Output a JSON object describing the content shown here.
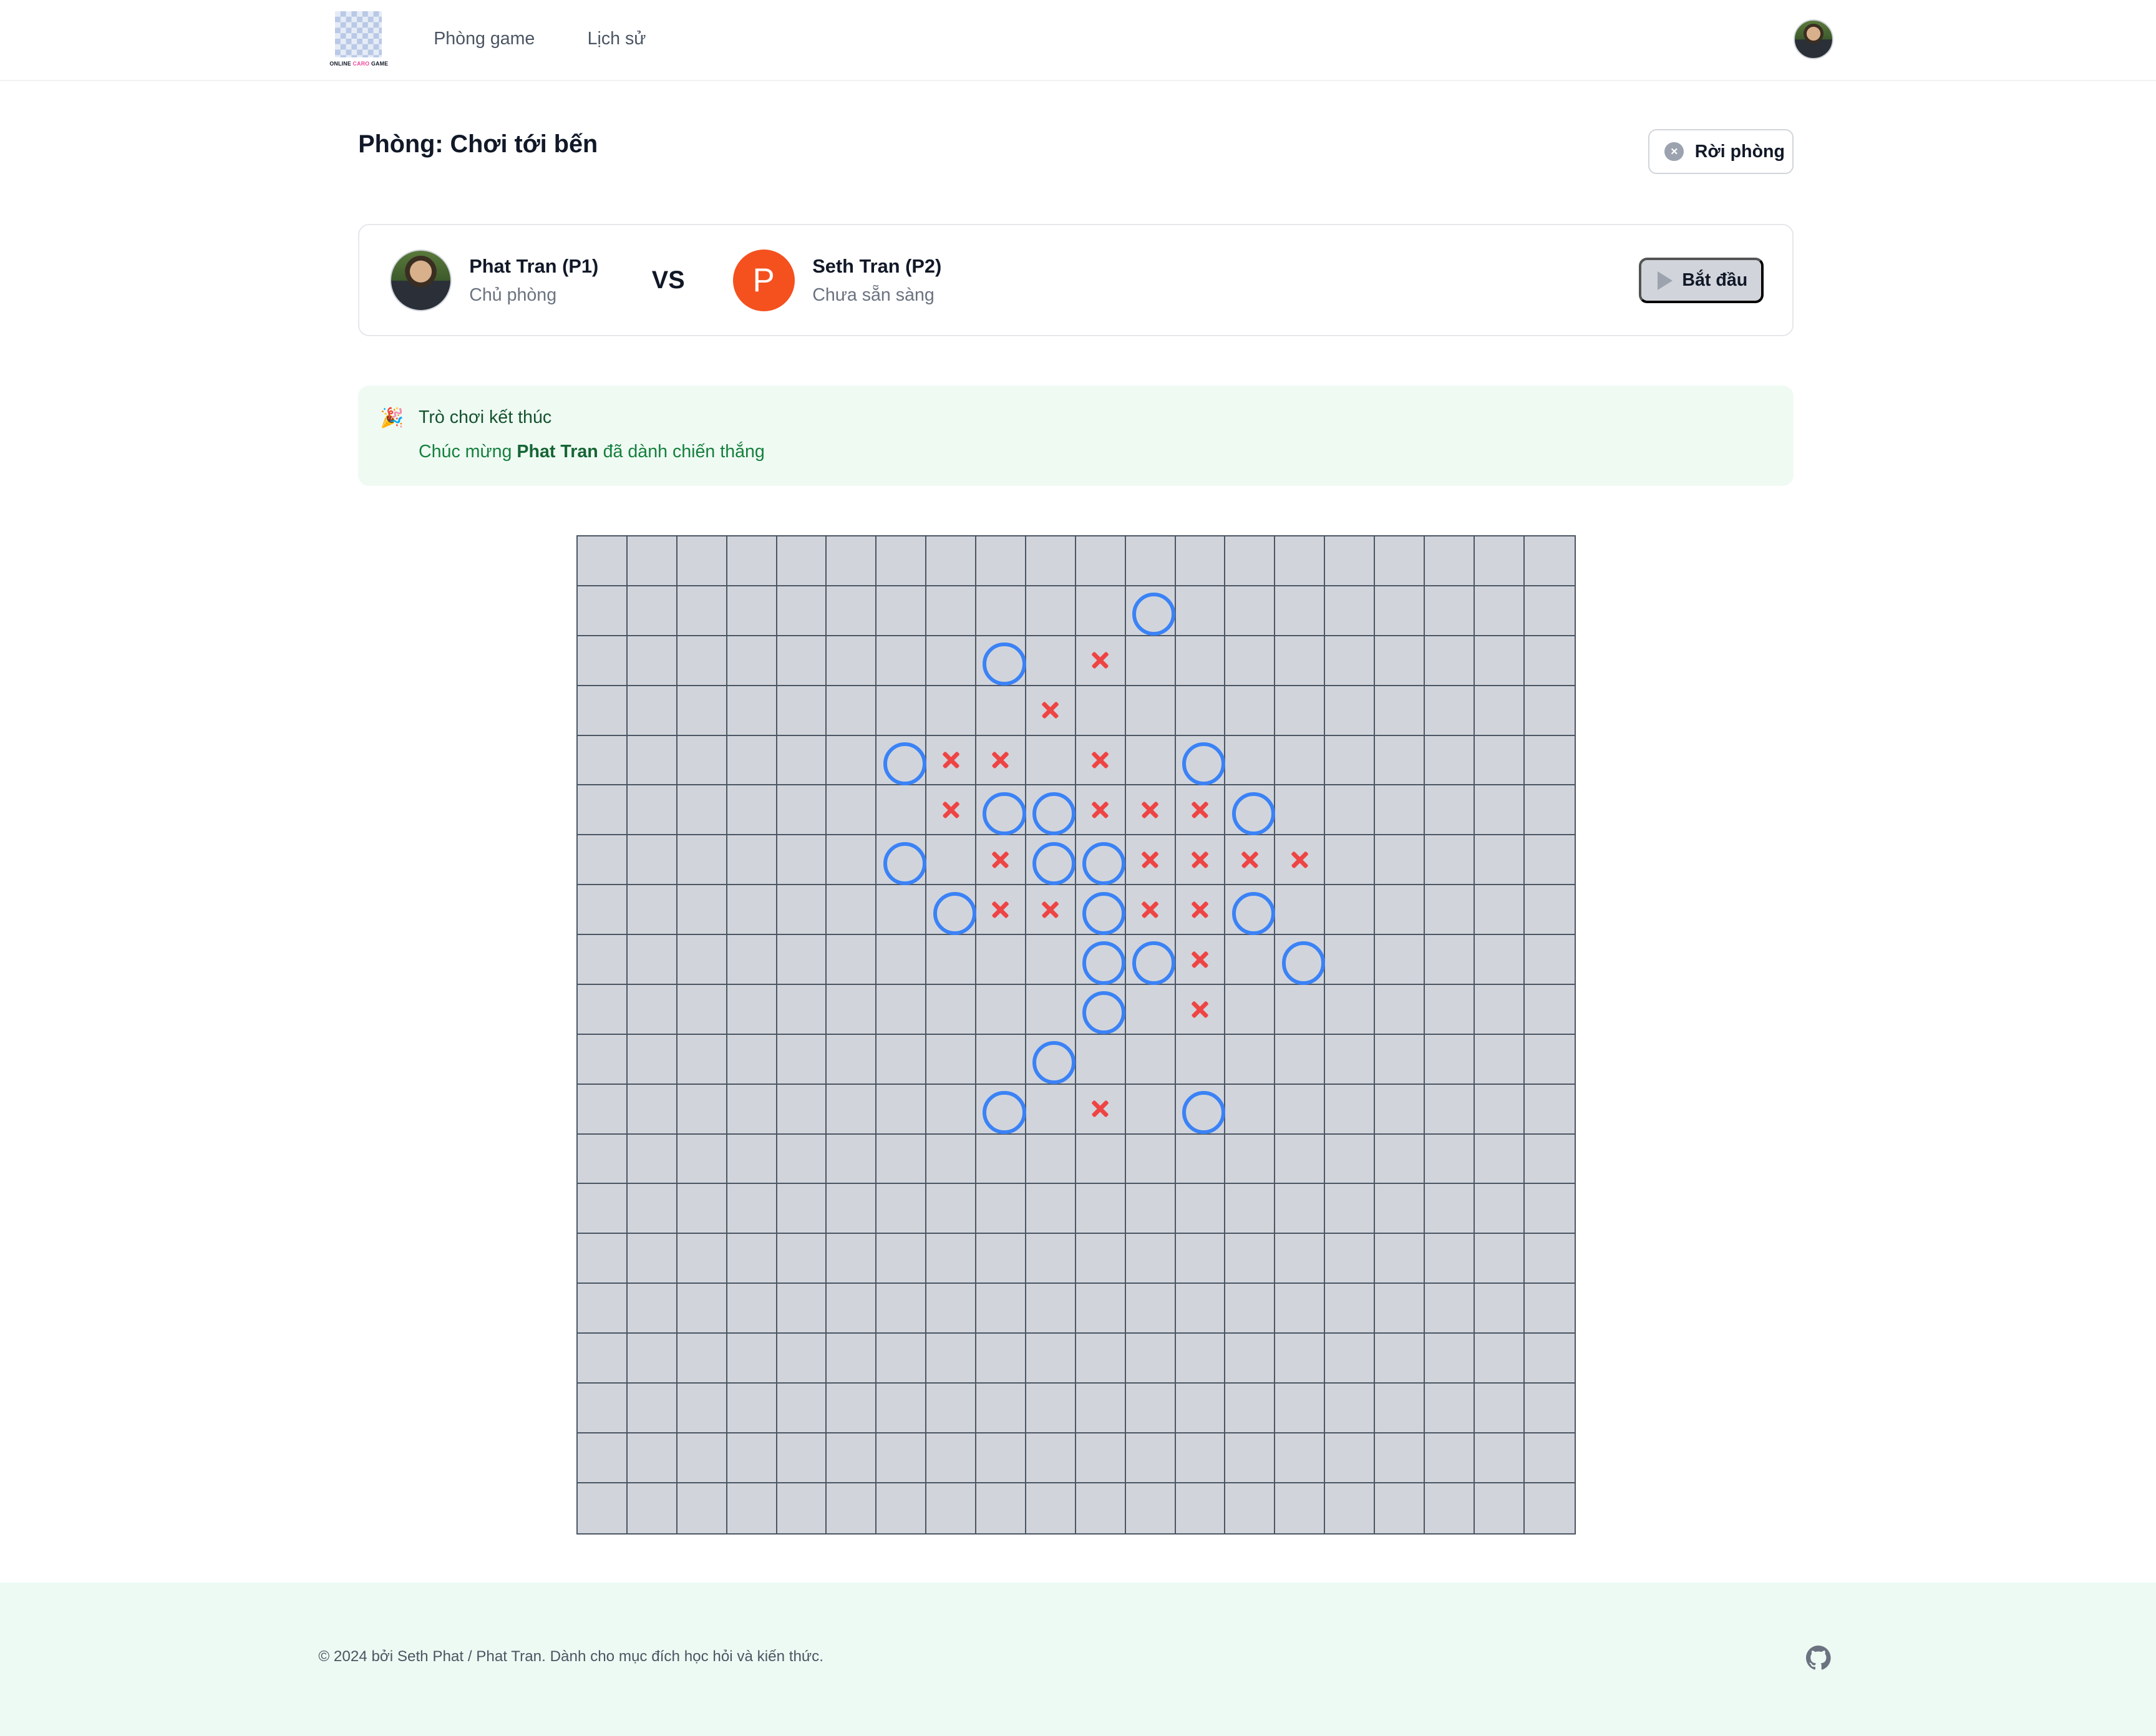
{
  "nav": {
    "logo_text": {
      "left": "ONLINE",
      "mid": "CARO",
      "right": "GAME"
    },
    "links": [
      "Phòng game",
      "Lịch sử"
    ]
  },
  "room": {
    "title": "Phòng: Chơi tới bến",
    "leave_label": "Rời phòng"
  },
  "players": {
    "p1": {
      "name": "Phat Tran (P1)",
      "status": "Chủ phòng"
    },
    "vs": "VS",
    "p2": {
      "name": "Seth Tran (P2)",
      "status": "Chưa sẵn sàng",
      "initial": "P",
      "color": "#f4511e"
    },
    "start_label": "Bắt đầu"
  },
  "result": {
    "title": "Trò chơi kết thúc",
    "prefix": "Chúc mừng",
    "winner": "Phat Tran",
    "suffix": "đã dành chiến thắng"
  },
  "board": {
    "size": 20,
    "colors": {
      "o": "#3b82f6",
      "x": "#ef4444",
      "cell": "#d1d5db"
    },
    "moves": [
      {
        "row": 1,
        "col": 11,
        "mark": "o"
      },
      {
        "row": 2,
        "col": 8,
        "mark": "o"
      },
      {
        "row": 2,
        "col": 10,
        "mark": "x"
      },
      {
        "row": 3,
        "col": 9,
        "mark": "x"
      },
      {
        "row": 4,
        "col": 6,
        "mark": "o"
      },
      {
        "row": 4,
        "col": 7,
        "mark": "x"
      },
      {
        "row": 4,
        "col": 8,
        "mark": "x"
      },
      {
        "row": 4,
        "col": 10,
        "mark": "x"
      },
      {
        "row": 4,
        "col": 12,
        "mark": "o"
      },
      {
        "row": 5,
        "col": 7,
        "mark": "x"
      },
      {
        "row": 5,
        "col": 8,
        "mark": "o"
      },
      {
        "row": 5,
        "col": 9,
        "mark": "o"
      },
      {
        "row": 5,
        "col": 10,
        "mark": "x"
      },
      {
        "row": 5,
        "col": 11,
        "mark": "x"
      },
      {
        "row": 5,
        "col": 12,
        "mark": "x"
      },
      {
        "row": 5,
        "col": 13,
        "mark": "o"
      },
      {
        "row": 6,
        "col": 6,
        "mark": "o"
      },
      {
        "row": 6,
        "col": 8,
        "mark": "x"
      },
      {
        "row": 6,
        "col": 9,
        "mark": "o"
      },
      {
        "row": 6,
        "col": 10,
        "mark": "o"
      },
      {
        "row": 6,
        "col": 11,
        "mark": "x"
      },
      {
        "row": 6,
        "col": 12,
        "mark": "x"
      },
      {
        "row": 6,
        "col": 13,
        "mark": "x"
      },
      {
        "row": 6,
        "col": 14,
        "mark": "x"
      },
      {
        "row": 7,
        "col": 7,
        "mark": "o"
      },
      {
        "row": 7,
        "col": 8,
        "mark": "x"
      },
      {
        "row": 7,
        "col": 9,
        "mark": "x"
      },
      {
        "row": 7,
        "col": 10,
        "mark": "o"
      },
      {
        "row": 7,
        "col": 11,
        "mark": "x"
      },
      {
        "row": 7,
        "col": 12,
        "mark": "x"
      },
      {
        "row": 7,
        "col": 13,
        "mark": "o"
      },
      {
        "row": 8,
        "col": 10,
        "mark": "o"
      },
      {
        "row": 8,
        "col": 11,
        "mark": "o"
      },
      {
        "row": 8,
        "col": 12,
        "mark": "x"
      },
      {
        "row": 8,
        "col": 14,
        "mark": "o"
      },
      {
        "row": 9,
        "col": 10,
        "mark": "o"
      },
      {
        "row": 9,
        "col": 12,
        "mark": "x"
      },
      {
        "row": 10,
        "col": 9,
        "mark": "o"
      },
      {
        "row": 11,
        "col": 8,
        "mark": "o"
      },
      {
        "row": 11,
        "col": 10,
        "mark": "x"
      },
      {
        "row": 11,
        "col": 12,
        "mark": "o"
      }
    ]
  },
  "footer": {
    "text": "© 2024 bởi Seth Phat / Phat Tran. Dành cho mục đích học hỏi và kiến thức."
  }
}
